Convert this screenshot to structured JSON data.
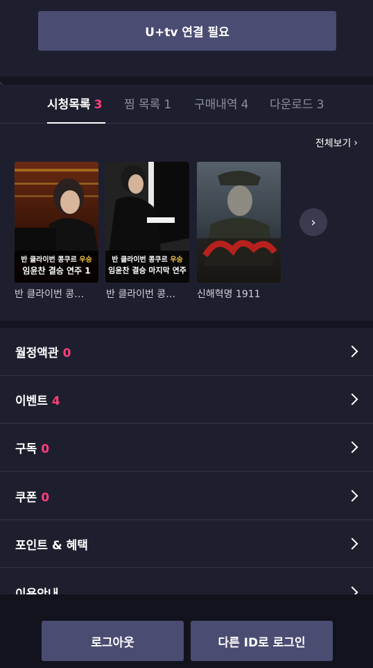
{
  "header": {
    "connect_label": "U+tv 연결 필요"
  },
  "tabs": [
    {
      "label": "시청목록",
      "count": "3",
      "active": true
    },
    {
      "label": "찜 목록",
      "count": "1",
      "active": false
    },
    {
      "label": "구매내역",
      "count": "4",
      "active": false
    },
    {
      "label": "다운로드",
      "count": "3",
      "active": false
    }
  ],
  "view_all": "전체보기",
  "items": [
    {
      "title": "반 클라이번 콩…",
      "poster_line1_a": "반 클라이번 콩쿠르 ",
      "poster_line1_b": "우승",
      "poster_line2": "임윤찬 결승 연주 1"
    },
    {
      "title": "반 클라이번 콩…",
      "poster_line1_a": "반 클라이번 콩쿠르 ",
      "poster_line1_b": "우승",
      "poster_line2": "임윤찬 결승 마지막 연주"
    },
    {
      "title": "신해혁명 1911",
      "poster_line1_a": "",
      "poster_line1_b": "",
      "poster_line2": ""
    }
  ],
  "menu": [
    {
      "label": "월정액관",
      "count": "0"
    },
    {
      "label": "이벤트",
      "count": "4"
    },
    {
      "label": "구독",
      "count": "0"
    },
    {
      "label": "쿠폰",
      "count": "0"
    },
    {
      "label": "포인트 & 혜택",
      "count": ""
    },
    {
      "label": "이용안내",
      "count": ""
    }
  ],
  "footer": {
    "logout_label": "로그아웃",
    "switch_label": "다른 ID로 로그인"
  },
  "colors": {
    "accent": "#ff3f7a",
    "button": "#4b4c72",
    "background": "#1e1f2e"
  }
}
